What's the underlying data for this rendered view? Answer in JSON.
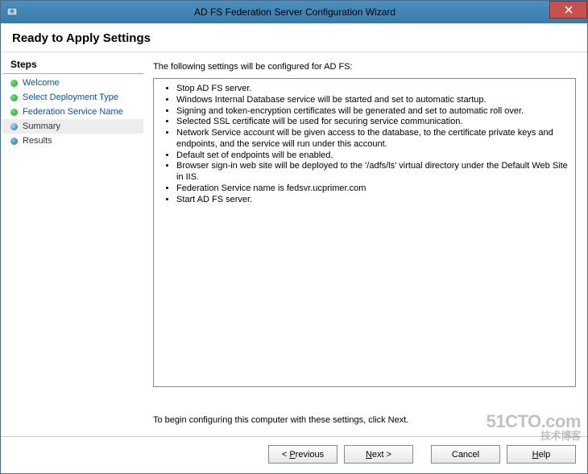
{
  "window": {
    "title": "AD FS Federation Server Configuration Wizard"
  },
  "heading": "Ready to Apply Settings",
  "sidebar": {
    "header": "Steps",
    "items": [
      {
        "label": "Welcome",
        "state": "done"
      },
      {
        "label": "Select Deployment Type",
        "state": "done"
      },
      {
        "label": "Federation Service Name",
        "state": "done"
      },
      {
        "label": "Summary",
        "state": "current"
      },
      {
        "label": "Results",
        "state": "pending"
      }
    ]
  },
  "main": {
    "intro": "The following settings will be configured for AD FS:",
    "bullets": [
      "Stop AD FS server.",
      "Windows Internal Database service will be started and set to automatic startup.",
      "Signing and token-encryption certificates will be generated and set to automatic roll over.",
      "Selected SSL certificate will be used for securing service communication.",
      "Network Service account will be given access to the database, to the certificate private keys and endpoints, and the service will run under this account.",
      "Default set of endpoints will be enabled.",
      "Browser sign-in web site will be deployed to the '/adfs/ls' virtual directory under the Default Web Site in IIS.",
      "Federation Service name is fedsvr.ucprimer.com",
      "Start AD FS server."
    ],
    "footer": "To begin configuring this computer with these settings, click Next."
  },
  "buttons": {
    "previous_pre": "< ",
    "previous_u": "P",
    "previous_post": "revious",
    "next_u": "N",
    "next_post": "ext >",
    "cancel": "Cancel",
    "help_u": "H",
    "help_post": "elp"
  },
  "watermark": {
    "line1": "51CTO.com",
    "line2": "技术博客"
  }
}
